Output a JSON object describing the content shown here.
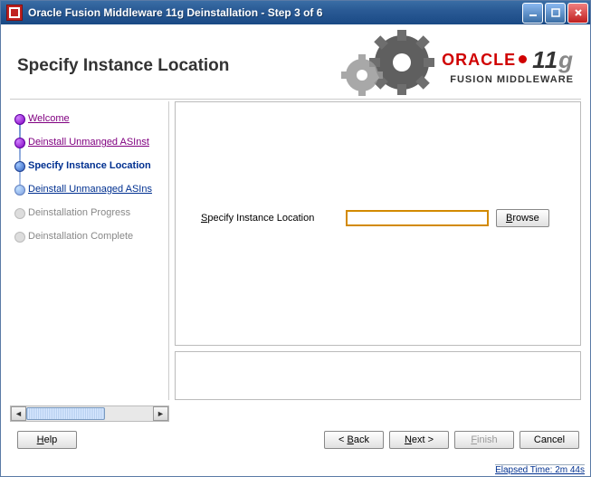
{
  "window": {
    "title": "Oracle Fusion Middleware 11g Deinstallation - Step 3 of 6"
  },
  "header": {
    "page_title": "Specify Instance Location",
    "brand_line1": "ORACLE",
    "brand_version_num": "11",
    "brand_version_suffix": "g",
    "brand_line2": "FUSION MIDDLEWARE"
  },
  "sidebar": {
    "steps": [
      {
        "label": "Welcome",
        "state": "done"
      },
      {
        "label": "Deinstall Unmanged ASInst",
        "state": "done"
      },
      {
        "label": "Specify Instance Location",
        "state": "current"
      },
      {
        "label": "Deinstall Unmanaged ASIns",
        "state": "next"
      },
      {
        "label": "Deinstallation Progress",
        "state": "future"
      },
      {
        "label": "Deinstallation Complete",
        "state": "future"
      }
    ]
  },
  "form": {
    "label_prefix": "S",
    "label_rest": "pecify Instance Location",
    "input_value": "",
    "browse_prefix": "B",
    "browse_rest": "rowse"
  },
  "buttons": {
    "help_prefix": "H",
    "help_rest": "elp",
    "back_prefix": "B",
    "back_rest": "ack",
    "back_arrow": "< ",
    "next_prefix": "N",
    "next_rest": "ext",
    "next_arrow": " >",
    "finish_prefix": "F",
    "finish_rest": "inish",
    "cancel": "Cancel"
  },
  "status": {
    "elapsed": "Elapsed Time: 2m 44s"
  }
}
